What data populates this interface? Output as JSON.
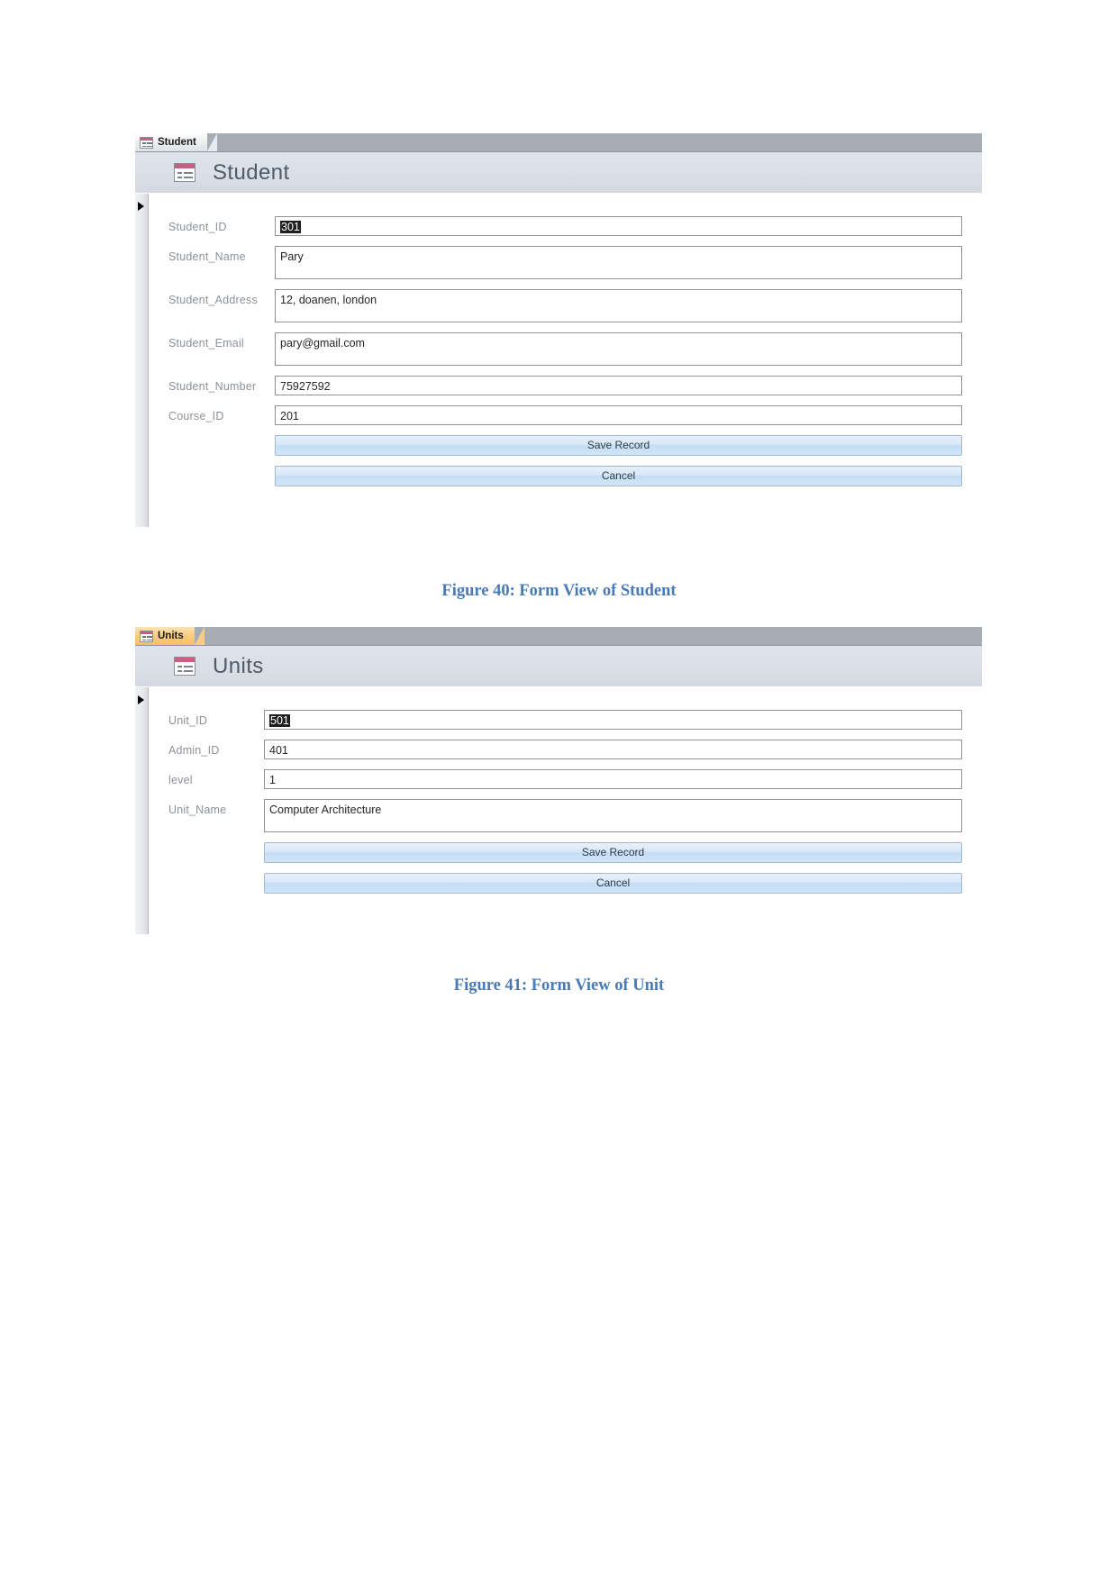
{
  "document": {
    "captions": {
      "figure_40": "Figure 40: Form View of Student",
      "figure_41": "Figure 41: Form View of Unit"
    }
  },
  "colors": {
    "tab_bar": "#a6adb4",
    "active_tab_orange": "#fbcd80",
    "form_header": "#dadee6",
    "title_text": "#4f5b66",
    "label_text": "#8d9298",
    "button_blue": "#c3ddf4",
    "caption_blue": "#4a7ab5"
  },
  "student_form": {
    "tab_label": "Student",
    "tab_icon": "table-form-icon",
    "title": "Student",
    "title_icon": "table-form-icon",
    "fields": [
      {
        "label": "Student_ID",
        "value": "301",
        "selected": true,
        "size": "h1"
      },
      {
        "label": "Student_Name",
        "value": "Pary",
        "selected": false,
        "size": "h2"
      },
      {
        "label": "Student_Address",
        "value": "12, doanen, london",
        "selected": false,
        "size": "h2"
      },
      {
        "label": "Student_Email",
        "value": "pary@gmail.com",
        "selected": false,
        "size": "h2"
      },
      {
        "label": "Student_Number",
        "value": "75927592",
        "selected": false,
        "size": "h1"
      },
      {
        "label": "Course_ID",
        "value": "201",
        "selected": false,
        "size": "h1"
      }
    ],
    "buttons": [
      {
        "label": "Save Record",
        "name": "save-record-button"
      },
      {
        "label": "Cancel",
        "name": "cancel-button"
      }
    ]
  },
  "units_form": {
    "tab_label": "Units",
    "tab_icon": "table-form-icon",
    "title": "Units",
    "title_icon": "table-form-icon",
    "fields": [
      {
        "label": "Unit_ID",
        "value": "501",
        "selected": true,
        "size": "h1"
      },
      {
        "label": "Admin_ID",
        "value": "401",
        "selected": false,
        "size": "h1"
      },
      {
        "label": "level",
        "value": "1",
        "selected": false,
        "size": "h1"
      },
      {
        "label": "Unit_Name",
        "value": "Computer Architecture",
        "selected": false,
        "size": "h2"
      }
    ],
    "buttons": [
      {
        "label": "Save Record",
        "name": "save-record-button"
      },
      {
        "label": "Cancel",
        "name": "cancel-button"
      }
    ]
  }
}
